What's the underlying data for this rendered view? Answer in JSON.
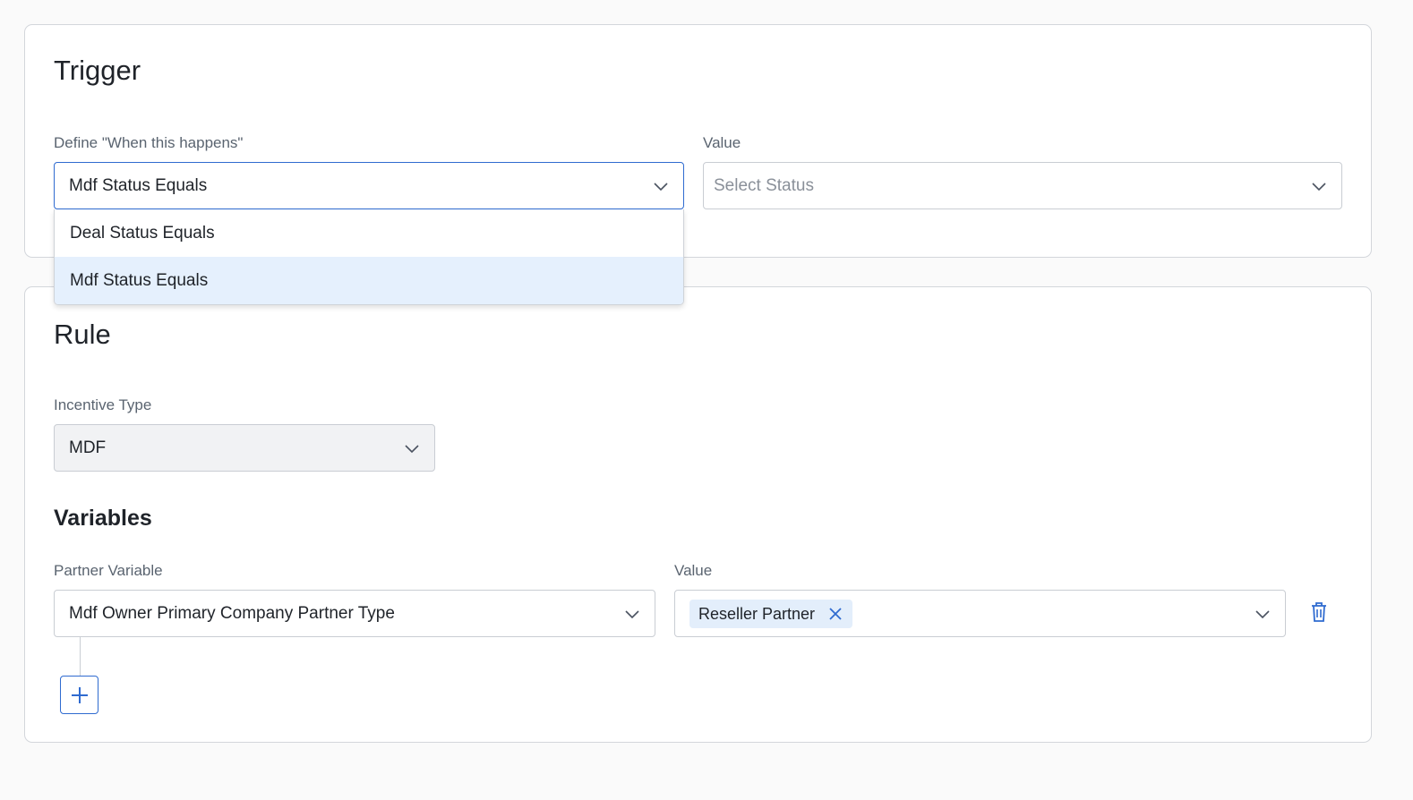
{
  "trigger": {
    "title": "Trigger",
    "define_label": "Define \"When this happens\"",
    "define_value": "Mdf Status Equals",
    "value_label": "Value",
    "value_placeholder": "Select Status",
    "options": [
      "Deal Status Equals",
      "Mdf Status Equals"
    ],
    "selected_option": "Mdf Status Equals"
  },
  "rule": {
    "title": "Rule",
    "incentive_label": "Incentive Type",
    "incentive_value": "MDF",
    "variables_title": "Variables",
    "partner_variable_label": "Partner Variable",
    "partner_variable_value": "Mdf Owner Primary Company Partner Type",
    "value_label": "Value",
    "value_chips": [
      "Reseller Partner"
    ]
  },
  "icons": {
    "chevron": "chevron-down-icon",
    "remove_chip": "close-icon",
    "delete": "trash-icon",
    "add": "plus-icon"
  },
  "colors": {
    "accent": "#2f6bd0",
    "selected_option_bg": "#e5f0fd",
    "chip_bg": "#e3eefb",
    "disabled_bg": "#f1f2f4"
  }
}
